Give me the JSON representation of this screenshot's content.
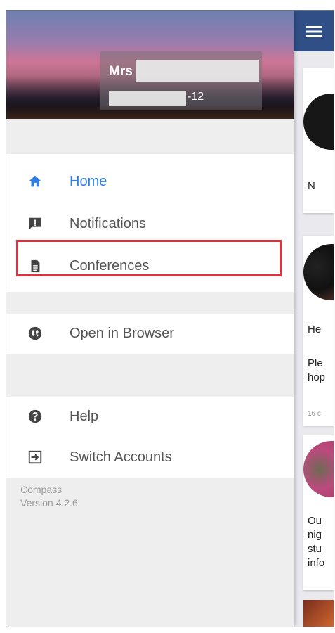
{
  "drawer": {
    "user": {
      "name": "Mrs",
      "suffix": "-12"
    },
    "menu_primary": [
      {
        "label": "Home",
        "icon": "home-icon",
        "active": true
      },
      {
        "label": "Notifications",
        "icon": "notification-alert-icon",
        "active": false
      },
      {
        "label": "Conferences",
        "icon": "document-icon",
        "active": false
      }
    ],
    "menu_browser": [
      {
        "label": "Open in Browser",
        "icon": "globe-icon"
      }
    ],
    "menu_account": [
      {
        "label": "Help",
        "icon": "help-circle-icon"
      },
      {
        "label": "Switch Accounts",
        "icon": "switch-account-icon"
      }
    ],
    "footer": {
      "app_name": "Compass",
      "version": "Version 4.2.6"
    },
    "colors": {
      "active": "#2e7ee6",
      "highlight": "#e0323e"
    }
  },
  "behind": {
    "appbar_icon": "menu-icon",
    "snippets": [
      "N",
      "He",
      "Ple",
      "hop",
      "Ou",
      "nig",
      "stu",
      "info"
    ],
    "time": "16 c"
  }
}
